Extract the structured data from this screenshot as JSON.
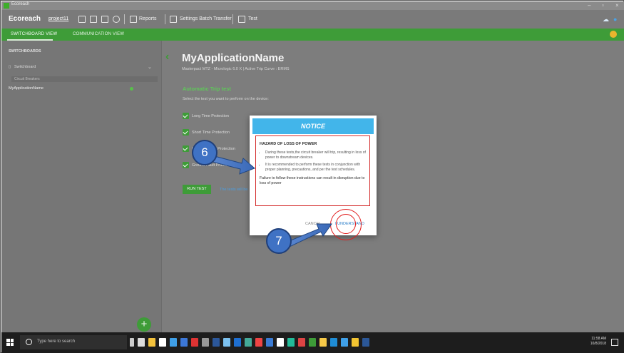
{
  "window": {
    "title": "Ecoreach"
  },
  "toolbar": {
    "brand": "Ecoreach",
    "project": "project11",
    "reports": "Reports",
    "settings_batch_transfer": "Settings Batch Transfer",
    "test": "Test"
  },
  "tabs": [
    {
      "label": "SWITCHBOARD VIEW",
      "active": true
    },
    {
      "label": "COMMUNICATION VIEW",
      "active": false
    }
  ],
  "sidebar": {
    "header": "SWITCHBOARDS",
    "switchboard": "Switchboard",
    "group": "Circuit Breakers",
    "item": "MyApplicationName"
  },
  "main": {
    "title": "MyApplicationName",
    "subtitle": "Masterpact MTZ - Micrologic 6.0 X  |  Active Trip Curve : ERMS",
    "section_title": "Automatic Trip test",
    "section_desc": "Select the test you want to perform on the device:",
    "checks": [
      "Long Time Protection",
      "Short Time Protection",
      "Instantaneous Protection",
      "Ground Fault Protection"
    ],
    "run_button": "RUN TEST",
    "run_note": "The tests will be"
  },
  "dialog": {
    "header": "NOTICE",
    "hazard_title": "HAZARD OF LOSS OF POWER",
    "bullets": [
      "During these tests,the circuit breaker will trip, resulting in loss of power to downstream devices.",
      "It is recommended to perform these tests in conjunction with proper planning, precautions, and per the test schedules."
    ],
    "failure_note": "Failure to follow these instructions can result in disruption due to loss of power",
    "cancel": "CANCEL",
    "understand": "I UNDERSTAND"
  },
  "annotations": {
    "step6": "6",
    "step7": "7"
  },
  "taskbar": {
    "search_placeholder": "Type here to search",
    "time": "11:58 AM",
    "date": "10/8/2018"
  },
  "colors": {
    "brand_green": "#3e9c38",
    "notice_blue": "#42b5ea",
    "warning_red": "#d32a2a",
    "callout_blue": "#3f72c4"
  }
}
